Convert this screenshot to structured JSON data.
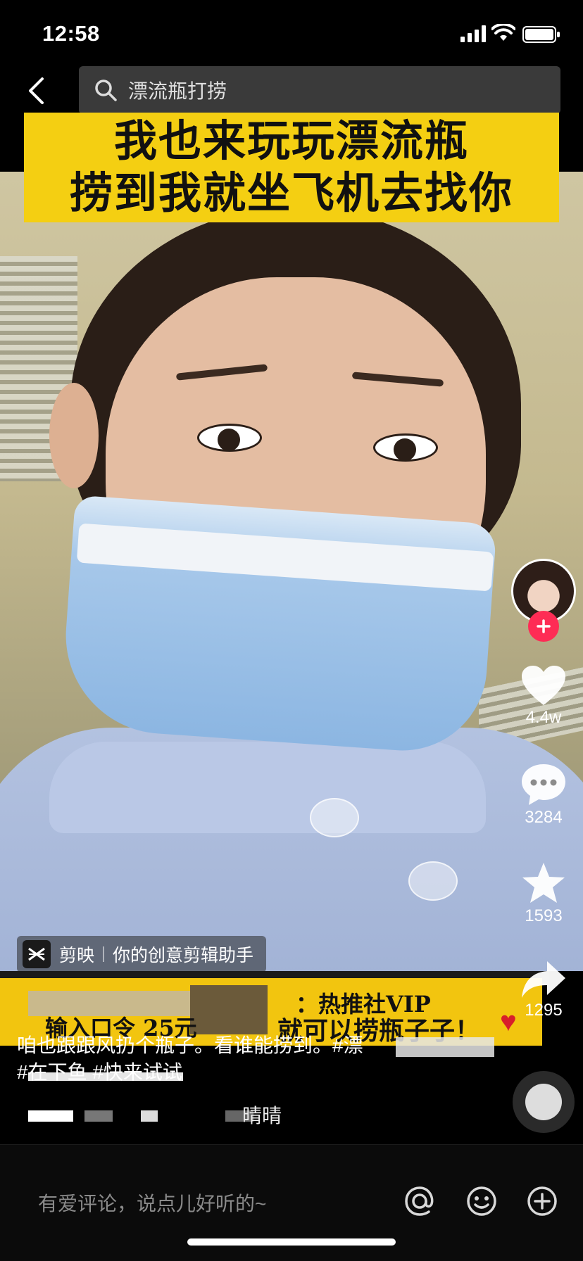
{
  "status_bar": {
    "time": "12:58"
  },
  "search": {
    "query": "漂流瓶打捞"
  },
  "video": {
    "overlay_title": [
      "我也来玩玩漂流瓶",
      "捞到我就坐飞机去找你"
    ],
    "watermark": {
      "app_name": "剪映",
      "slogan": "你的创意剪辑助手"
    },
    "promo_banner": {
      "text_1": "：热推社VIP",
      "text_2": "输入口令   25元",
      "text_3": "就可以捞瓶子子！"
    }
  },
  "actions": {
    "likes": "4.4w",
    "comments": "3284",
    "favorites": "1593",
    "shares": "1295"
  },
  "caption": {
    "text": "咱也跟跟风扔个瓶子。看谁能捞到。#漂",
    "tags": "#在下鱼 #快来试试"
  },
  "music": {
    "name": "晴晴"
  },
  "comment_bar": {
    "placeholder": "有爱评论，说点儿好听的~"
  },
  "colors": {
    "accent": "#fe2c55",
    "banner_yellow": "#f4cf12",
    "background": "#000000"
  },
  "icons": [
    "back-arrow-icon",
    "search-icon",
    "heart-icon",
    "comment-bubble-icon",
    "star-icon",
    "share-arrow-icon",
    "at-sign-icon",
    "emoji-icon",
    "plus-circle-icon",
    "follow-plus-icon",
    "capcut-icon"
  ]
}
